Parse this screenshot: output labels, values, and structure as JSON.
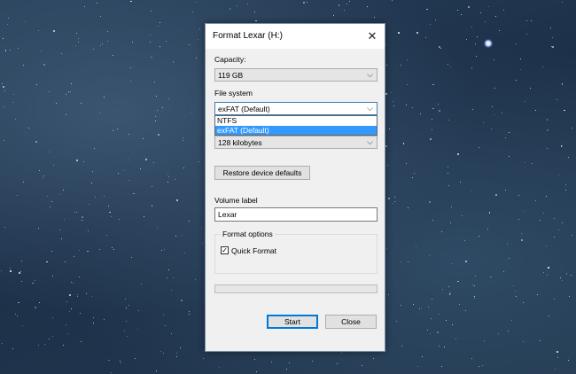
{
  "dialog": {
    "title": "Format Lexar (H:)",
    "capacity": {
      "label": "Capacity:",
      "value": "119 GB"
    },
    "file_system": {
      "label": "File system",
      "value": "exFAT (Default)",
      "options": [
        "NTFS",
        "exFAT (Default)"
      ],
      "selected_index": 1
    },
    "allocation_unit": {
      "value": "128 kilobytes"
    },
    "restore_button": "Restore device defaults",
    "volume_label": {
      "label": "Volume label",
      "value": "Lexar"
    },
    "format_options": {
      "title": "Format options",
      "quick_format_label": "Quick Format",
      "quick_format_checked": true
    },
    "progress": 0,
    "buttons": {
      "start": "Start",
      "close": "Close"
    }
  },
  "icons": {
    "close": "close-icon",
    "chevron": "chevron-down-icon",
    "check": "checkmark-icon"
  },
  "colors": {
    "selection": "#3399ff",
    "focus_border": "#0078d7",
    "dialog_bg": "#f0f0f0"
  }
}
